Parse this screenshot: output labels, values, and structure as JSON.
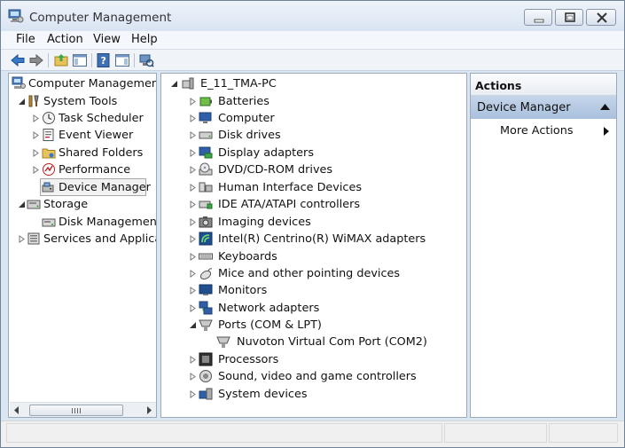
{
  "window": {
    "title": "Computer Management"
  },
  "menu": [
    "File",
    "Action",
    "View",
    "Help"
  ],
  "left_tree": [
    {
      "label": "Computer Management",
      "icon": "computer-management-icon"
    },
    {
      "label": "System Tools",
      "icon": "system-tools-icon"
    },
    {
      "label": "Task Scheduler",
      "icon": "clock-icon"
    },
    {
      "label": "Event Viewer",
      "icon": "event-viewer-icon"
    },
    {
      "label": "Shared Folders",
      "icon": "shared-folder-icon"
    },
    {
      "label": "Performance",
      "icon": "performance-icon"
    },
    {
      "label": "Device Manager",
      "icon": "device-manager-icon"
    },
    {
      "label": "Storage",
      "icon": "storage-icon"
    },
    {
      "label": "Disk Management",
      "icon": "disk-management-icon"
    },
    {
      "label": "Services and Applicat",
      "icon": "services-icon"
    }
  ],
  "device_tree": {
    "root": "E_11_TMA-PC",
    "items": [
      {
        "label": "Batteries"
      },
      {
        "label": "Computer"
      },
      {
        "label": "Disk drives"
      },
      {
        "label": "Display adapters"
      },
      {
        "label": "DVD/CD-ROM drives"
      },
      {
        "label": "Human Interface Devices"
      },
      {
        "label": "IDE ATA/ATAPI controllers"
      },
      {
        "label": "Imaging devices"
      },
      {
        "label": "Intel(R) Centrino(R) WiMAX adapters"
      },
      {
        "label": "Keyboards"
      },
      {
        "label": "Mice and other pointing devices"
      },
      {
        "label": "Monitors"
      },
      {
        "label": "Network adapters"
      },
      {
        "label": "Ports (COM & LPT)"
      },
      {
        "label": "Nuvoton Virtual Com Port (COM2)"
      },
      {
        "label": "Processors"
      },
      {
        "label": "Sound, video and game controllers"
      },
      {
        "label": "System devices"
      }
    ]
  },
  "actions": {
    "header": "Actions",
    "section": "Device Manager",
    "more": "More Actions"
  },
  "colors": {
    "selection": "#a9c0dd",
    "window_frame": "#dbe6f3"
  }
}
